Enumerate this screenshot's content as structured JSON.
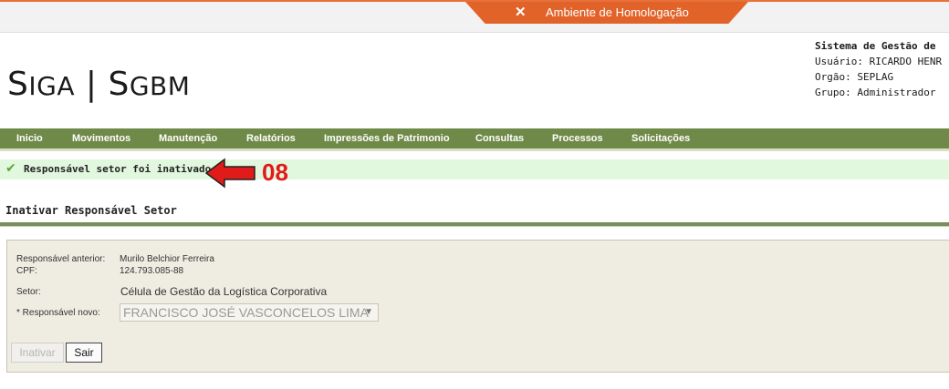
{
  "environment": {
    "label": "Ambiente de Homologação",
    "icon": "tools-icon"
  },
  "logo": {
    "part1_big": "S",
    "part1_small": "I",
    "part1_rest_big": "G",
    "part1_end_small": "A",
    "separator": " | ",
    "part2_big": "S",
    "part2_small": "GBM"
  },
  "system": {
    "title": "Sistema de Gestão de",
    "user": "Usuário: RICARDO HENR",
    "org": "Orgão: SEPLAG",
    "group": "Grupo: Administrador"
  },
  "nav": {
    "items": [
      "Inicio",
      "Movimentos",
      "Manutenção",
      "Relatórios",
      "Impressões de Patrimonio",
      "Consultas",
      "Processos",
      "Solicitações"
    ]
  },
  "message": {
    "icon": "checkmark-icon",
    "text": "Responsável setor foi inativado."
  },
  "annotation": {
    "number": "08",
    "color": "#e11a1a"
  },
  "page": {
    "title": "Inativar Responsável Setor"
  },
  "form": {
    "previous_label": "Responsável anterior:",
    "previous_value": "Murilo Belchior Ferreira",
    "cpf_label": "CPF:",
    "cpf_value": "124.793.085-88",
    "sector_label": "Setor:",
    "sector_value": "Célula de Gestão da Logística Corporativa",
    "new_label": "* Responsável novo:",
    "new_value": "FRANCISCO JOSÉ VASCONCELOS LIMA",
    "inactivate_label": "Inativar",
    "exit_label": "Sair"
  },
  "colors": {
    "nav": "#6f8a48",
    "env": "#e2632a",
    "success_bg": "#e1f7de",
    "form_bg": "#efece2"
  }
}
